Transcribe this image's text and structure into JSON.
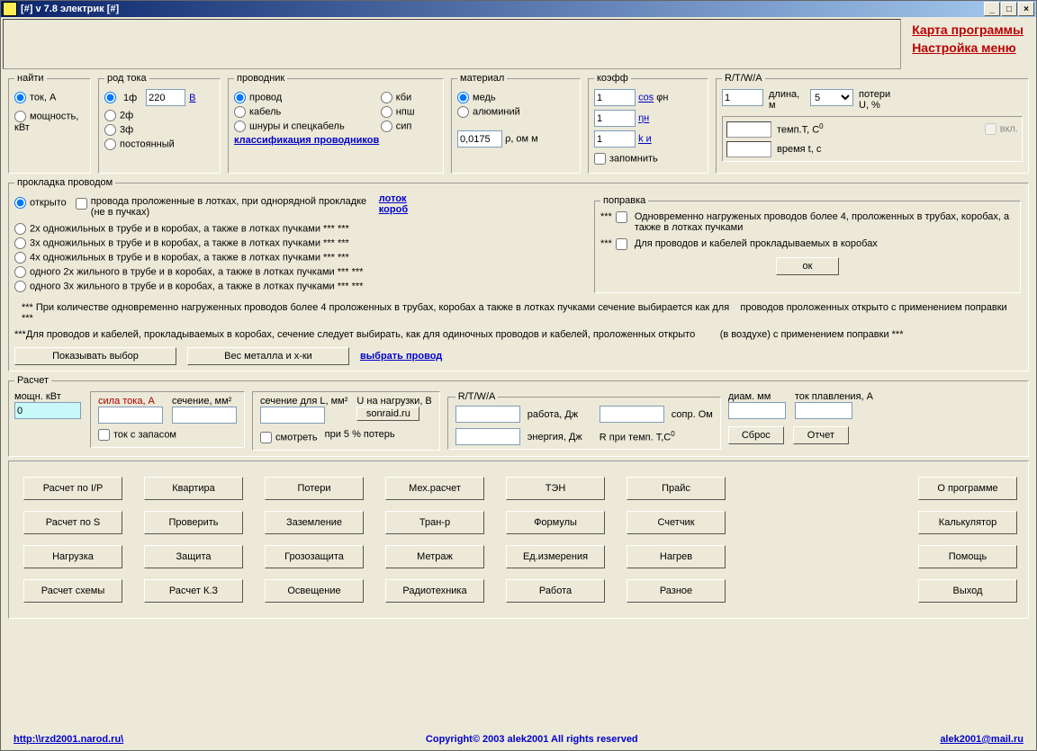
{
  "window": {
    "title": "[#]  v 7.8 электрик  [#]"
  },
  "topmenu": {
    "karta": "Карта программы",
    "nastroyka": "Настройка меню"
  },
  "find": {
    "legend": "найти",
    "tok": "ток, А",
    "moshch": "мощность, кВт"
  },
  "rod": {
    "legend": "род тока",
    "f1": "1ф",
    "f2": "2ф",
    "f3": "3ф",
    "post": "постоянный",
    "V": "В",
    "volts": "220"
  },
  "prov": {
    "legend": "проводник",
    "provod": "провод",
    "kabel": "кабель",
    "shnury": "шнуры и спецкабель",
    "kbi": "кби",
    "npsh": "нпш",
    "sip": "сип",
    "klass": "классификация проводников"
  },
  "mat": {
    "legend": "материал",
    "med": "медь",
    "al": "алюминий",
    "rho_val": "0,0175",
    "rho_lbl": "ρ,  ом м"
  },
  "kof": {
    "legend": "коэфф",
    "v1": "1",
    "v2": "1",
    "v3": "1",
    "cos": "cos",
    "phi": "φн",
    "eta": "ηн",
    "ki": "k и",
    "remember": "запомнить"
  },
  "rtwa": {
    "legend": "R/T/W/A",
    "v1": "1",
    "dlina": "длина, м",
    "sel": "5",
    "pot": "потери U, %",
    "tempT": "темп.T, С",
    "vkl": "вкл.",
    "vrem": "время t, с"
  },
  "lay": {
    "legend": "прокладка проводом",
    "open": "открыто",
    "chk": "провода проложенные в лотках, при однорядной прокладке (не в пучках)",
    "lotok": "лоток",
    "korob": "короб",
    "r1": "2х одножильных в трубе и в коробах, а также в лотках пучками *** ***",
    "r2": "3х одножильных в трубе и в коробах, а также в лотках пучками *** ***",
    "r3": "4х одножильных в трубе и в коробах, а также в лотках пучками *** ***",
    "r4": "одного 2х жильного в трубе и в коробах, а также в лотках пучками *** ***",
    "r5": "одного 3х жильного в трубе и в коробах, а также в лотках пучками *** ***"
  },
  "pravka": {
    "legend": "поправка",
    "p1": "Одновременно нагруженых проводов более 4, проложенных в трубах, коробах, а также в лотках пучками",
    "p2": "Для проводов и кабелей прокладываемых в коробах",
    "ok": "ок",
    "star": "***"
  },
  "notes": {
    "n1": "*** При количестве одновременно нагруженных проводов более 4 проложенных в трубах, коробах а также в лотках пучками сечение выбирается как для    проводов проложенных открыто с применением поправки ***",
    "n2": "***Для проводов и кабелей, прокладываемых в коробах, сечение следует выбирать, как для одиночных проводов и кабелей, проложенных открыто         (в воздухе) с применением поправки ***"
  },
  "b": {
    "show": "Показывать выбор",
    "weight": "Вес металла и х-ки",
    "choose": "выбрать провод"
  },
  "calc": {
    "legend": "Расчет",
    "moshch": "мощн. кВт",
    "sila": "сила тока, А",
    "sech": "сечение, мм²",
    "val0": "0",
    "tokzap": "ток с запасом",
    "sechL": "сечение для L, мм²",
    "Unagr": "U на нагрузки, В",
    "sonraid": "sonraid.ru",
    "smotret": "смотреть",
    "pri5": "при 5 % потерь",
    "rabota": "работа, Дж",
    "energ": "энергия, Дж",
    "sopr": "сопр. Ом",
    "Rpri": "R при темп. T,С",
    "diam": "диам. мм",
    "tokpl": "ток плавления, А",
    "sbros": "Сброс",
    "otchet": "Отчет"
  },
  "gb": {
    "b11": "Расчет по I/P",
    "b12": "Квартира",
    "b13": "Потери",
    "b14": "Мех.расчет",
    "b15": "ТЭН",
    "b16": "Прайс",
    "b21": "Расчет по S",
    "b22": "Проверить",
    "b23": "Заземление",
    "b24": "Тран-р",
    "b25": "Формулы",
    "b26": "Счетчик",
    "b31": "Нагрузка",
    "b32": "Защита",
    "b33": "Грозозащита",
    "b34": "Метраж",
    "b35": "Ед.измерения",
    "b36": "Нагрев",
    "b41": "Расчет схемы",
    "b42": "Расчет К.З",
    "b43": "Освещение",
    "b44": "Радиотехника",
    "b45": "Работа",
    "b46": "Разное"
  },
  "rb": {
    "about": "О программе",
    "kalk": "Калькулятор",
    "help": "Помощь",
    "exit": "Выход"
  },
  "footer": {
    "url": "http:\\\\rzd2001.narod.ru\\",
    "copy": "Copyright© 2003 alek2001 All rights reserved",
    "mail": "alek2001@mail.ru"
  }
}
